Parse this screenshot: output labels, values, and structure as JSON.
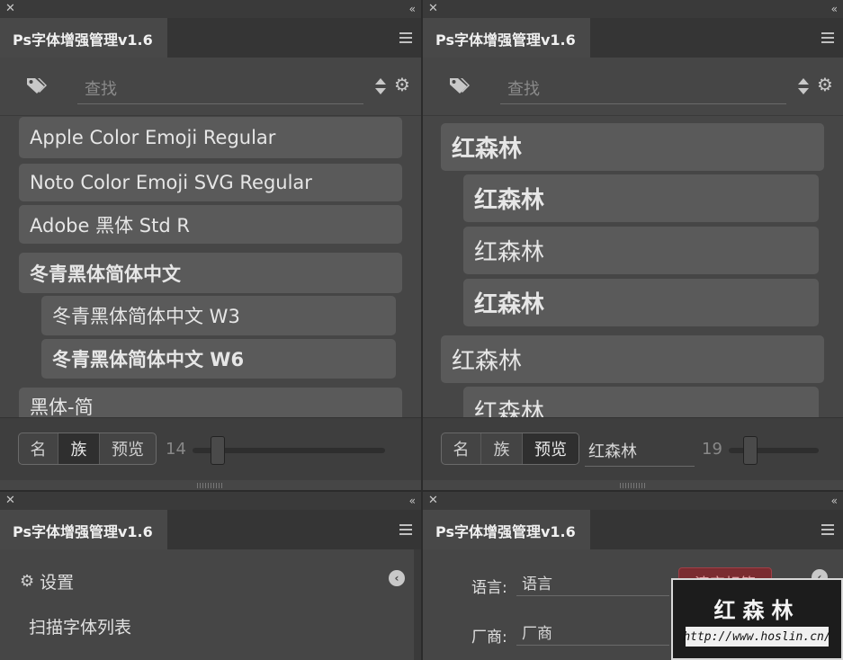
{
  "app_title": "Ps字体增强管理v1.6",
  "search": {
    "placeholder": "查找"
  },
  "panel1": {
    "fonts": [
      {
        "label": "Apple   Color   Emoji   Regular"
      },
      {
        "label": "Noto Color Emoji SVG Regular"
      },
      {
        "label": "Adobe 黑体 Std R"
      },
      {
        "label": "冬青黑体简体中文"
      },
      {
        "label": "冬青黑体简体中文 W3"
      },
      {
        "label": "冬青黑体简体中文 W6"
      },
      {
        "label": "黑体-简"
      }
    ],
    "modes": [
      "名",
      "族",
      "预览"
    ],
    "active_mode": "族",
    "font_size": "14"
  },
  "panel2": {
    "previews": [
      {
        "label": "红森林"
      },
      {
        "label": "红森林"
      },
      {
        "label": "红森林"
      },
      {
        "label": "红森林"
      },
      {
        "label": "红森林"
      },
      {
        "label": "红森林"
      }
    ],
    "modes": [
      "名",
      "族",
      "预览"
    ],
    "active_mode": "预览",
    "preview_text": "红森林",
    "font_size": "19"
  },
  "panel3": {
    "settings_label": "设置",
    "scan_label": "扫描字体列表"
  },
  "panel4": {
    "language_label": "语言:",
    "language_value": "语言",
    "vendor_label": "厂商:",
    "vendor_value": "厂商",
    "clear_tags_label": "清空标签"
  },
  "watermark": {
    "title": "红森林",
    "url": "http://www.hoslin.cn/"
  },
  "colors": {
    "panel_bg": "#464646",
    "item_bg": "#5a5a5a",
    "accent_red": "#7a2c30"
  }
}
